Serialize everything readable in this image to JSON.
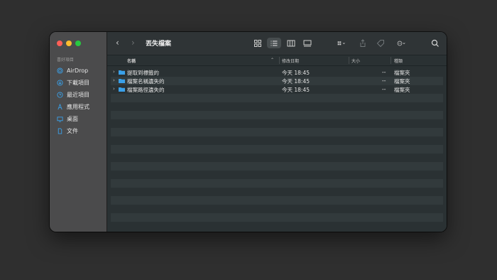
{
  "window": {
    "title": "丟失檔案"
  },
  "sidebar": {
    "section_title": "喜好項目",
    "items": [
      {
        "label": "AirDrop",
        "icon": "airdrop-icon"
      },
      {
        "label": "下載項目",
        "icon": "download-icon"
      },
      {
        "label": "最近項目",
        "icon": "clock-icon"
      },
      {
        "label": "應用程式",
        "icon": "applications-icon"
      },
      {
        "label": "桌面",
        "icon": "desktop-icon"
      },
      {
        "label": "文件",
        "icon": "document-icon"
      }
    ]
  },
  "toolbar": {
    "back": "‹",
    "forward": "›",
    "icons": [
      "icon-view-icon",
      "list-view-icon",
      "column-view-icon",
      "gallery-view-icon",
      "group-icon",
      "share-icon",
      "tag-icon",
      "more-icon",
      "search-icon"
    ]
  },
  "columns": {
    "name": "名稱",
    "date": "修改日期",
    "size": "大小",
    "kind": "種類"
  },
  "files": [
    {
      "name": "提取到標籤的",
      "date": "今天 18:45",
      "size": "--",
      "kind": "檔案夾"
    },
    {
      "name": "檔案名稱遺失的",
      "date": "今天 18:45",
      "size": "--",
      "kind": "檔案夾"
    },
    {
      "name": "檔案路徑遺失的",
      "date": "今天 18:45",
      "size": "--",
      "kind": "檔案夾"
    }
  ],
  "colors": {
    "folder": "#3aa0e8",
    "accent": "#1e88e5"
  }
}
